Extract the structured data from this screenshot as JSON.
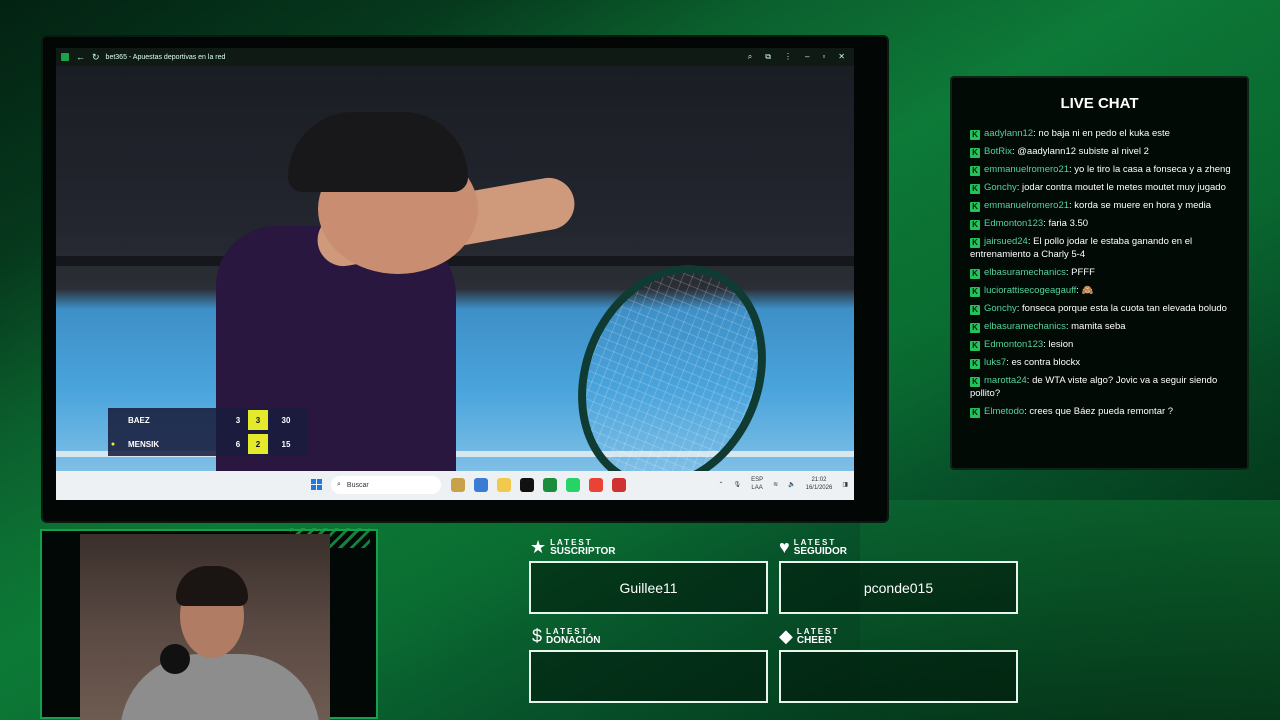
{
  "browser": {
    "window_title": "bet365 - Apuestas deportivas en la red"
  },
  "scoreboard": {
    "players": [
      {
        "name": "BAEZ",
        "sets": "3",
        "games": "3",
        "points": "30",
        "serving": false
      },
      {
        "name": "MENSIK",
        "sets": "6",
        "games": "2",
        "points": "15",
        "serving": true
      }
    ]
  },
  "taskbar": {
    "search_placeholder": "Buscar",
    "lang_top": "ESP",
    "lang_bottom": "LAA",
    "time": "21:02",
    "date": "16/1/2026"
  },
  "chat": {
    "title": "LIVE CHAT",
    "messages": [
      {
        "user": "aadylann12",
        "text": "no baja ni en pedo el kuka este"
      },
      {
        "user": "BotRix",
        "text": "@aadylann12 subiste al nivel 2"
      },
      {
        "user": "emmanuelromero21",
        "text": "yo le tiro la casa a fonseca y a zheng"
      },
      {
        "user": "Gonchy",
        "text": "jodar contra moutet le metes moutet muy jugado"
      },
      {
        "user": "emmanuelromero21",
        "text": "korda se muere en hora y media"
      },
      {
        "user": "Edmonton123",
        "text": "faria 3.50"
      },
      {
        "user": "jairsued24",
        "text": "El pollo jodar le estaba ganando en el entrenamiento a Charly 5-4"
      },
      {
        "user": "elbasuramechanics",
        "text": "PFFF"
      },
      {
        "user": "luciorattisecogeagauff",
        "text": "🙈"
      },
      {
        "user": "Gonchy",
        "text": "fonseca porque esta la cuota tan elevada boludo"
      },
      {
        "user": "elbasuramechanics",
        "text": "mamita seba"
      },
      {
        "user": "Edmonton123",
        "text": "lesion"
      },
      {
        "user": "luks7",
        "text": "es contra blockx"
      },
      {
        "user": "marotta24",
        "text": "de WTA viste algo? Jovic va a seguir siendo pollito?"
      },
      {
        "user": "Elmetodo",
        "text": "crees que Báez pueda remontar ?"
      }
    ]
  },
  "alerts": {
    "suscriptor": {
      "small": "LATEST",
      "big": "SUSCRIPTOR",
      "value": "Guillee11",
      "icon": "star-icon"
    },
    "seguidor": {
      "small": "LATEST",
      "big": "SEGUIDOR",
      "value": "pconde015",
      "icon": "heart-icon"
    },
    "donacion": {
      "small": "LATEST",
      "big": "DONACIÓN",
      "value": "",
      "icon": "dollar-icon"
    },
    "cheer": {
      "small": "LATEST",
      "big": "CHEER",
      "value": "",
      "icon": "diamond-icon"
    }
  },
  "colors": {
    "accent": "#17a04a",
    "chat_username": "#54d39d",
    "score_highlight": "#e4ea2b"
  }
}
